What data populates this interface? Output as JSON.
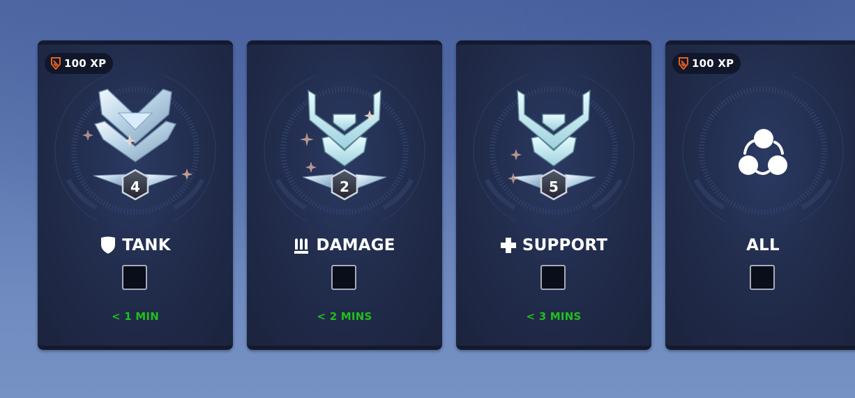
{
  "cards": [
    {
      "role": "TANK",
      "role_icon": "shield-icon",
      "rank_icon": "rank-emblem-icon",
      "rank_division": "4",
      "xp_badge": "100 XP",
      "wait_time": "< 1 MIN",
      "checked": false
    },
    {
      "role": "DAMAGE",
      "role_icon": "bullets-icon",
      "rank_icon": "rank-emblem-icon",
      "rank_division": "2",
      "xp_badge": "",
      "wait_time": "< 2 MINS",
      "checked": false
    },
    {
      "role": "SUPPORT",
      "role_icon": "cross-icon",
      "rank_icon": "rank-emblem-icon",
      "rank_division": "5",
      "xp_badge": "",
      "wait_time": "< 3 MINS",
      "checked": false
    },
    {
      "role": "ALL",
      "role_icon": "",
      "rank_icon": "all-roles-icon",
      "rank_division": "",
      "xp_badge": "100 XP",
      "wait_time": "",
      "checked": false
    }
  ],
  "colors": {
    "wait_green": "#1fc019",
    "xp_icon_orange": "#e8611d",
    "card_bg": "#222d4d"
  }
}
